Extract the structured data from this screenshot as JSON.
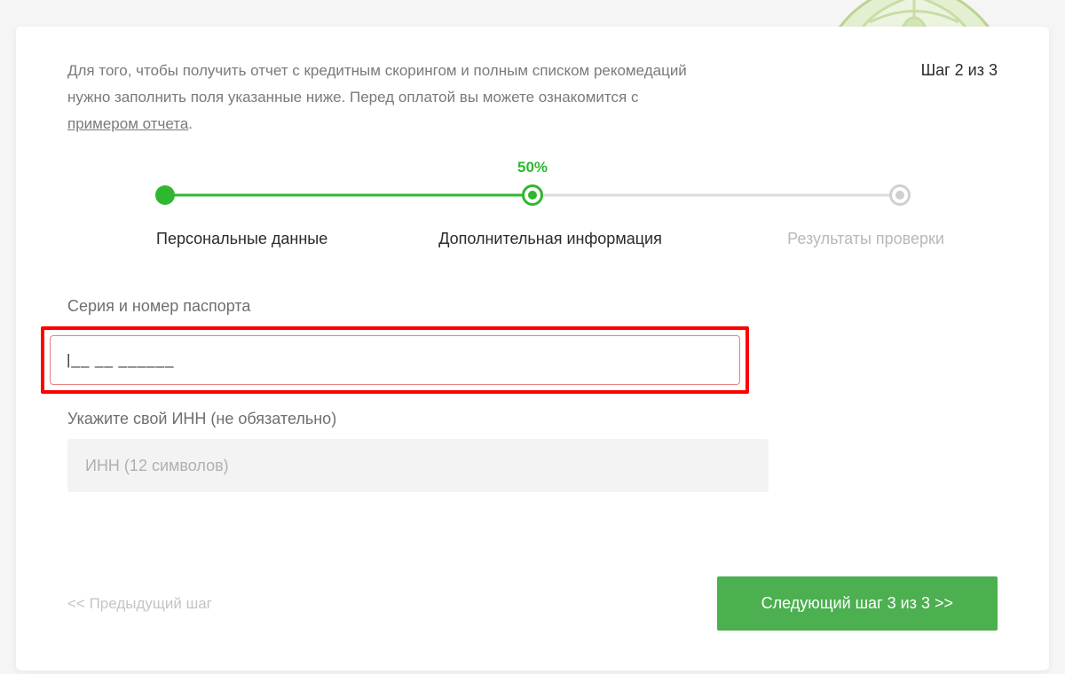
{
  "header": {
    "intro_before_link": "Для того, чтобы получить отчет с кредитным скорингом и полным списком рекомедаций нужно заполнить поля указанные ниже. Перед оплатой вы можете ознакомится с ",
    "intro_link_text": "примером отчета",
    "intro_after_link": ".",
    "step_text": "Шаг 2 из 3"
  },
  "progress": {
    "percent_label": "50%",
    "steps": {
      "personal": "Персональные данные",
      "additional": "Дополнительная информация",
      "results": "Результаты проверки"
    }
  },
  "form": {
    "passport_label": "Серия и номер паспорта",
    "passport_value": "|__ __ ______",
    "inn_label": "Укажите свой ИНН (не обязательно)",
    "inn_placeholder": "ИНН (12 символов)",
    "inn_value": ""
  },
  "nav": {
    "prev_label": "<< Предыдущий шаг",
    "next_label": "Следующий шаг 3 из 3 >>"
  },
  "colors": {
    "accent_green": "#2fb72f",
    "button_green": "#4caf50",
    "error_border": "#e88080",
    "highlight_red": "#ff0000"
  }
}
